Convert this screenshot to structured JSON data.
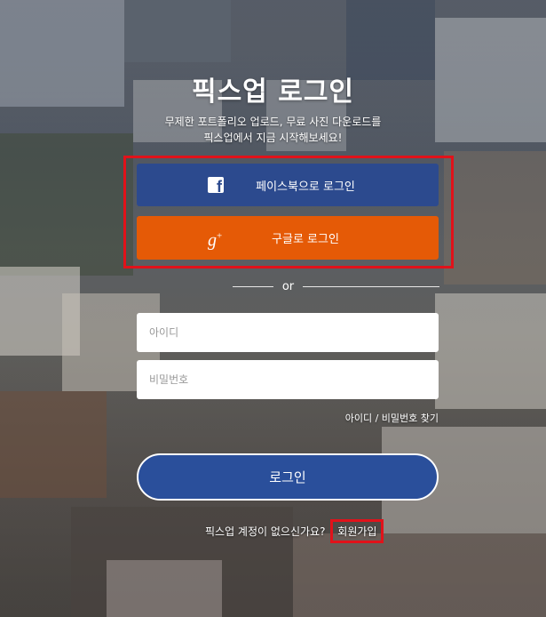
{
  "title": "픽스업 로그인",
  "subtitle": {
    "line1": "무제한 포트폴리오 업로드, 무료 사진 다운로드를",
    "line2": "픽스업에서 지금 시작해보세요!"
  },
  "social": {
    "facebook_label": "페이스북으로 로그인",
    "google_label": "구글로 로그인",
    "facebook_icon": "facebook-icon",
    "google_icon": "google-plus-icon"
  },
  "divider_text": "or",
  "form": {
    "id_placeholder": "아이디",
    "pw_placeholder": "비밀번호",
    "find_link": "아이디 / 비밀번호 찾기",
    "login_label": "로그인"
  },
  "signup": {
    "question": "픽스업 계정이 없으신가요?",
    "link": "회원가입"
  },
  "colors": {
    "facebook": "#2c4a8e",
    "google": "#e55a06",
    "login": "#2a4f9b",
    "highlight": "#e1121a"
  }
}
